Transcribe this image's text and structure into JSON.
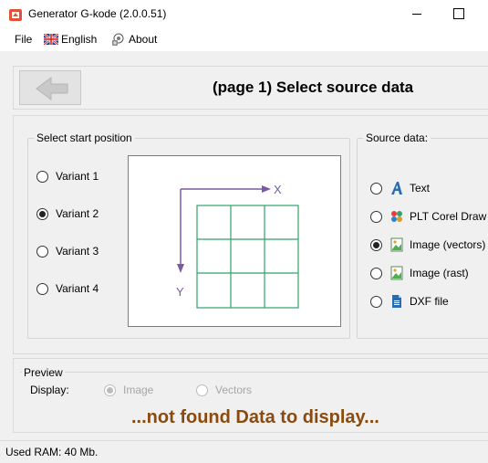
{
  "window": {
    "title": "Generator G-kode (2.0.0.51)"
  },
  "menu": {
    "file": "File",
    "language": "English",
    "about": "About"
  },
  "header": {
    "page_title": "(page 1) Select source data"
  },
  "start_position": {
    "legend": "Select start position",
    "options": [
      "Variant 1",
      "Variant 2",
      "Variant 3",
      "Variant 4"
    ],
    "selected": "Variant 2",
    "diagram": {
      "x_label": "X",
      "y_label": "Y",
      "grid_rows": 3,
      "grid_cols": 3,
      "grid_color": "#2fa36b",
      "arrow_color": "#7a5aa0"
    }
  },
  "source_data": {
    "legend": "Source data:",
    "options": [
      {
        "label": "Text",
        "icon": "text-icon"
      },
      {
        "label": "PLT Corel Draw",
        "icon": "corel-icon"
      },
      {
        "label": "Image (vectors)",
        "icon": "image-vectors-icon"
      },
      {
        "label": "Image (rast)",
        "icon": "image-raster-icon"
      },
      {
        "label": "DXF file",
        "icon": "dxf-file-icon"
      }
    ],
    "selected": "Image (vectors)"
  },
  "preview": {
    "legend": "Preview",
    "display_label": "Display:",
    "options": [
      "Image",
      "Vectors"
    ],
    "selected": "Image",
    "message": "...not found Data to display...",
    "message_color": "#8b4a0e"
  },
  "status": {
    "ram_text": "Used RAM:  40  Mb."
  }
}
